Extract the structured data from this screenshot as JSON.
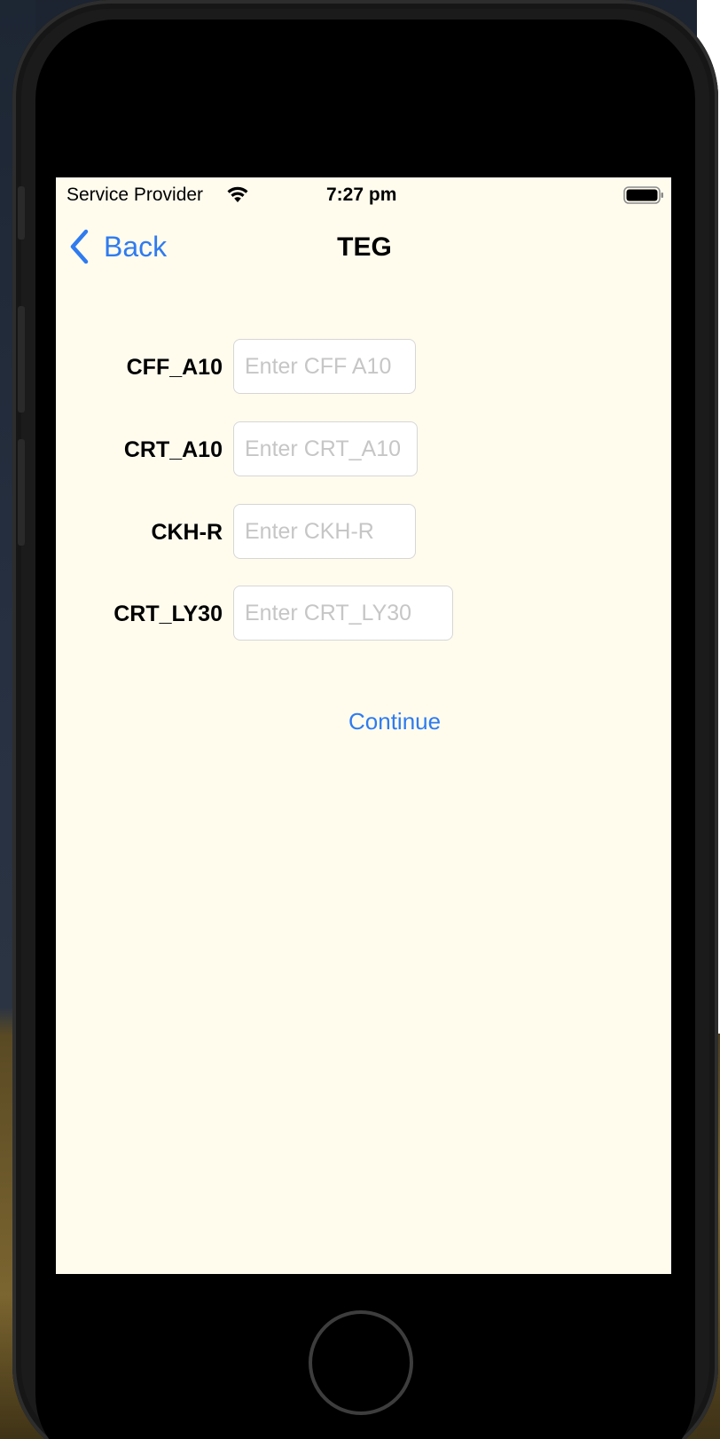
{
  "status_bar": {
    "carrier": "Service Provider",
    "time": "7:27 pm",
    "wifi_icon": "wifi-icon",
    "battery_icon": "battery-full-icon"
  },
  "nav": {
    "back_label": "Back",
    "back_icon": "chevron-left-icon",
    "title": "TEG"
  },
  "form": {
    "fields": [
      {
        "label": "CFF_A10",
        "placeholder": "Enter CFF A10",
        "value": ""
      },
      {
        "label": "CRT_A10",
        "placeholder": "Enter CRT_A10",
        "value": ""
      },
      {
        "label": "CKH-R",
        "placeholder": "Enter CKH-R",
        "value": ""
      },
      {
        "label": "CRT_LY30",
        "placeholder": "Enter CRT_LY30",
        "value": ""
      }
    ],
    "continue_label": "Continue"
  },
  "colors": {
    "screen_background": "#fffcee",
    "accent": "#2f7bf0",
    "placeholder": "#c6c6c6"
  }
}
